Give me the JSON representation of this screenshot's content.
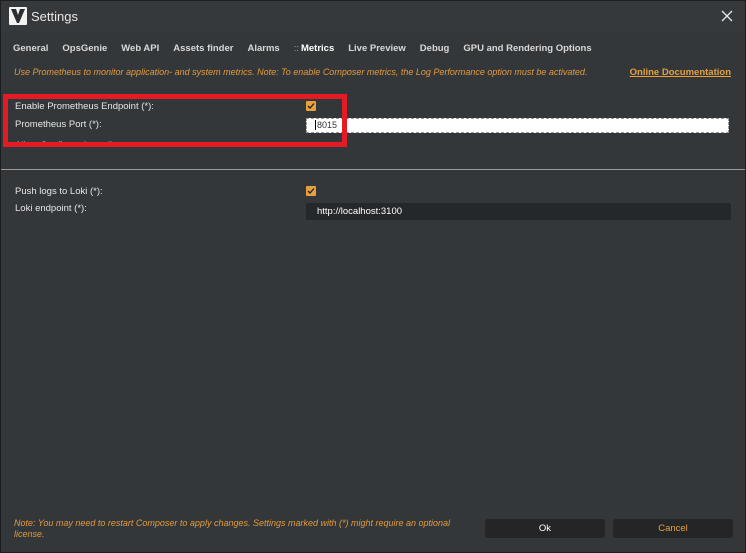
{
  "window": {
    "title": "Settings"
  },
  "tabs": [
    {
      "label": "General"
    },
    {
      "label": "OpsGenie"
    },
    {
      "label": "Web API"
    },
    {
      "label": "Assets finder"
    },
    {
      "label": "Alarms"
    },
    {
      "label": "Metrics",
      "prefix": "::",
      "active": true
    },
    {
      "label": "Live Preview"
    },
    {
      "label": "Debug"
    },
    {
      "label": "GPU and Rendering Options"
    }
  ],
  "description": "Use Prometheus to monitor application- and system metrics. Note: To enable Composer metrics, the Log Performance option must be activated.",
  "online_doc_label": "Online Documentation",
  "settings": {
    "enable_prometheus": {
      "label": "Enable Prometheus Endpoint (*):",
      "checked": true
    },
    "prometheus_port": {
      "label": "Prometheus Port (*):",
      "value": "8015"
    },
    "allow_config": {
      "label": "Allow Configuration edit"
    },
    "push_loki": {
      "label": "Push logs to Loki (*):",
      "checked": true
    },
    "loki_endpoint": {
      "label": "Loki endpoint (*):",
      "value": "http://localhost:3100"
    }
  },
  "footer": {
    "note": "Note: You may need to restart Composer to apply changes. Settings marked with (*) might require an optional license.",
    "ok_label": "Ok",
    "cancel_label": "Cancel"
  },
  "colors": {
    "accent": "#e8a03c",
    "highlight": "#e21b25",
    "background": "#33373a"
  },
  "icons": [
    "app-logo-icon",
    "close-icon",
    "checkmark-icon"
  ]
}
